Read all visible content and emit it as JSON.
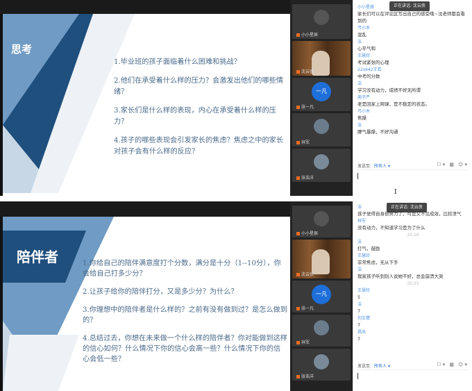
{
  "top": {
    "slide_title": "思考",
    "questions": [
      "1.毕业班的孩子面临着什么困难和挑战？",
      "2.他们在承受着什么样的压力？会激发出他们的哪些情绪？",
      "3.家长们是什么样的表现，内心在承受着什么样的压力？",
      "4.孩子的哪些表现会引发家长的焦虑？焦虑之中的家长对孩子会有什么样的反应？"
    ],
    "participants": [
      "小小星辰",
      "沈云侠",
      "张一凡",
      "祥军",
      "张浩洋"
    ],
    "avatar_initials": "一凡",
    "speaking": "正在讲话: 沈云侠",
    "messages": [
      {
        "name": "小小星辰",
        "text": "家长们可以在评论区写出自己的感受哦~沈老师都会看到的"
      },
      {
        "name": "弓小木",
        "text": "混乱"
      },
      {
        "name": "洁",
        "text": "心平气和"
      },
      {
        "name": "王慧欣",
        "text": "考试紧张的心理"
      },
      {
        "name": "22x642王若",
        "text": "中考的分数"
      },
      {
        "name": "洁",
        "text": "学习没有动力，成绩不好无所谓"
      },
      {
        "name": "周子严",
        "text": "老是回家上网课，是不稳定的状态。"
      },
      {
        "name": "弓小木",
        "text": "焦躁"
      },
      {
        "name": "洁",
        "text": "脾气暴躁，不好沟通"
      }
    ],
    "send_label": "发送至:",
    "send_target": "所有人 ▾",
    "tools": "☐▾ ▦ ☺▾"
  },
  "cursor_glyph": "I",
  "bottom": {
    "slide_title": "陪伴者",
    "questions": [
      "1.你给自己的陪伴满意度打个分数，满分是十分（1--10分），你会给自己打多少分？",
      "2.让孩子给你的陪伴打分，又是多少分？为什么？",
      "3.你理想中的陪伴者是什么样的？之前有没有做到过？是怎么做到的？",
      "4.总结过去，你想在未来做一个什么样的陪伴者？你对能做到这样的信心如何？什么情况下你的信心会高一些？什么情况下你的信心会低一些？"
    ],
    "participants": [
      "小小星辰",
      "沈云侠",
      "张一凡",
      "祥军",
      "张浩洋"
    ],
    "avatar_initials": "一凡",
    "speaking": "正在讲话: 沈云侠",
    "messages": [
      {
        "name": "洁",
        "text": "孩子觉得自身很努力了，可是又不见成效，比较泄气"
      },
      {
        "name": "祥军",
        "text": "没有动力，不知道学习是为了什么"
      },
      {
        "time": "20:16"
      },
      {
        "name": "洁",
        "text": "打气，鼓励"
      },
      {
        "name": "王慧欣",
        "text": "非常焦虑，无从下手"
      },
      {
        "name": "洁",
        "text": "我家孩子听到别人说她不好，总会崩溃大哭"
      },
      {
        "time": "20:25"
      },
      {
        "name": "王慧欣",
        "text": "5"
      },
      {
        "name": "洁",
        "text": "7"
      },
      {
        "name": "刘文倩",
        "text": "7"
      },
      {
        "name": "昌凤",
        "text": "7"
      }
    ],
    "send_label": "发送至:",
    "send_target": "所有人 ▾",
    "tools": "☐▾ ▦ ☺▾"
  }
}
